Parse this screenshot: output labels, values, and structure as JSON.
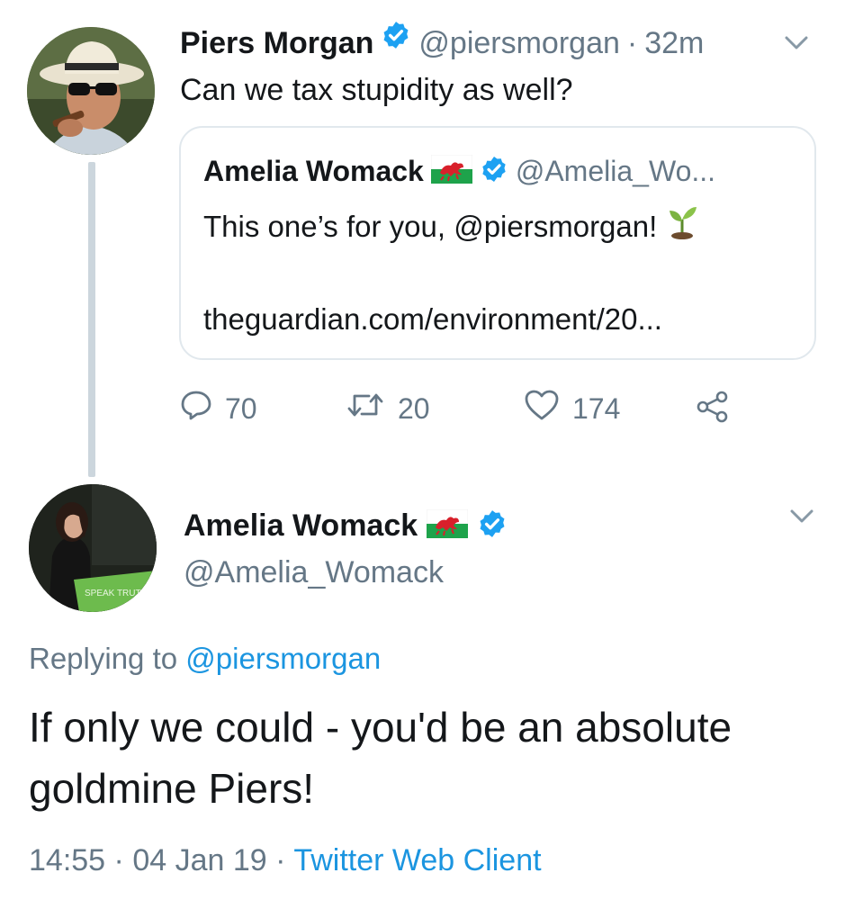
{
  "colors": {
    "text_primary": "#14171a",
    "text_secondary": "#657786",
    "link_blue": "#1b95e0",
    "verified_blue": "#1da1f2",
    "border": "#e1e8ed",
    "thread_line": "#ccd6dd"
  },
  "tweet1": {
    "display_name": "Piers Morgan",
    "verified": true,
    "handle": "@piersmorgan",
    "separator": "·",
    "time": "32m",
    "text": "Can we tax stupidity as well?",
    "menu_icon": "chevron-down-icon",
    "quoted": {
      "display_name": "Amelia Womack",
      "flag_icon": "welsh-flag-icon",
      "verified": true,
      "handle": "@Amelia_Wo...",
      "text": "This one’s for you, @piersmorgan!",
      "emoji_icon": "seedling-icon",
      "link": "theguardian.com/environment/20..."
    },
    "actions": {
      "reply_count": "70",
      "retweet_count": "20",
      "like_count": "174"
    }
  },
  "tweet2": {
    "display_name": "Amelia Womack",
    "flag_icon": "welsh-flag-icon",
    "verified": true,
    "handle": "@Amelia_Womack",
    "replying_label": "Replying to",
    "replying_to": "@piersmorgan",
    "text": "If only we could - you'd be an absolute goldmine Piers!",
    "time": "14:55",
    "separator": "·",
    "date": "04 Jan 19",
    "client": "Twitter Web Client",
    "menu_icon": "chevron-down-icon"
  }
}
